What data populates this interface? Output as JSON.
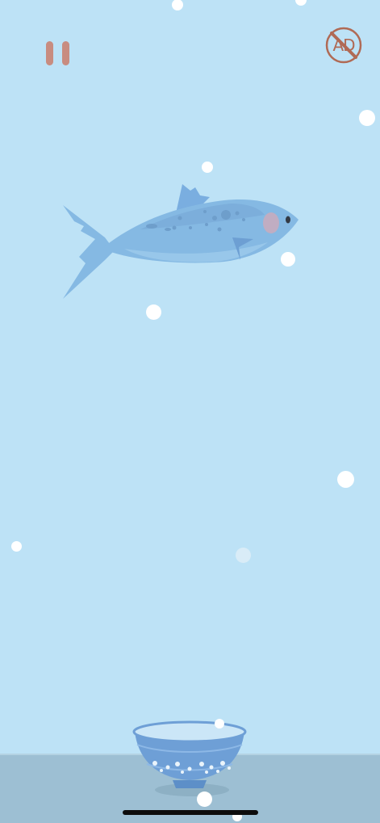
{
  "game": {
    "controls": {
      "pause_icon": "pause-icon",
      "no_ads_label": "AD",
      "no_ads_icon": "no-ads-icon"
    },
    "colors": {
      "sky": "#bde2f6",
      "table": "#9dbfd3",
      "button_tint": "#c88c80",
      "no_ads_tint": "#b06a55",
      "fish_body": "#85b9e3",
      "bowl_body": "#6e9fd6",
      "dot": "#ffffff"
    }
  }
}
